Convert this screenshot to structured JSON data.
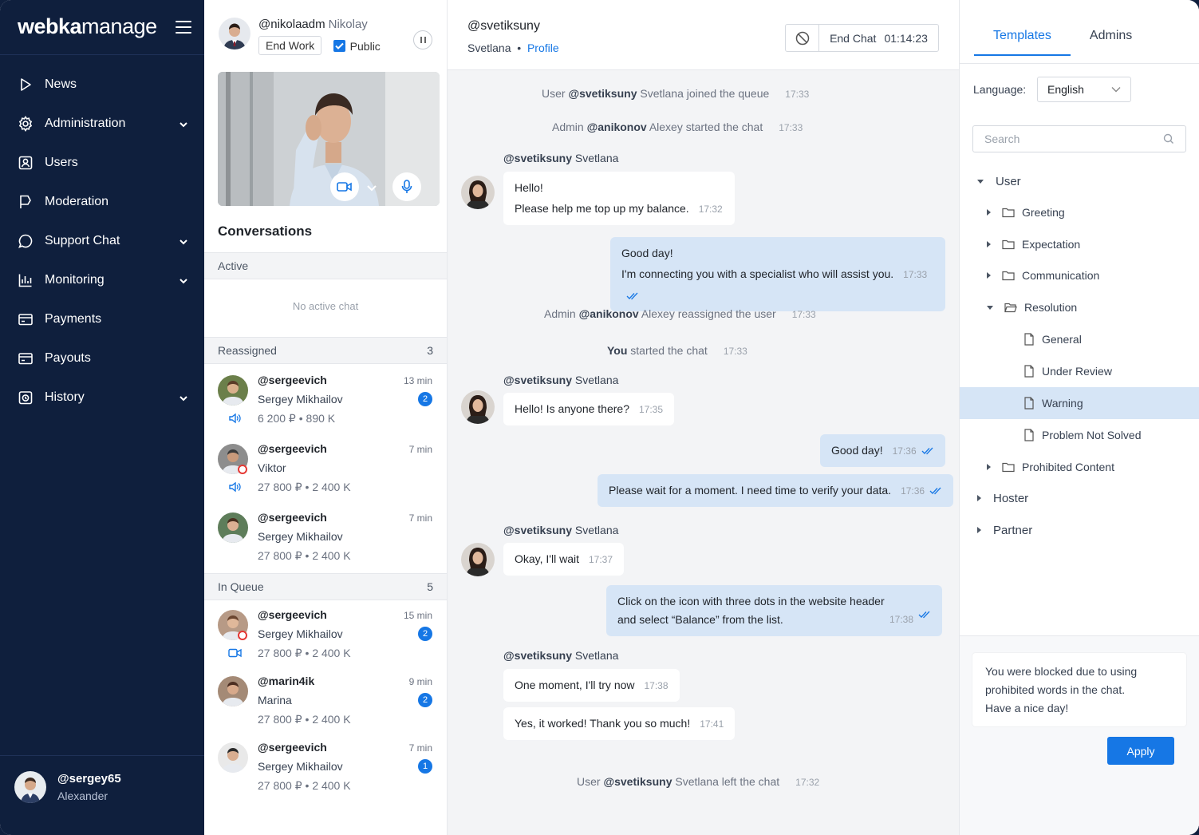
{
  "brand": {
    "bold": "webka",
    "light": "manage"
  },
  "nav": [
    {
      "label": "News",
      "icon": "play-triangle-icon",
      "expandable": false
    },
    {
      "label": "Administration",
      "icon": "gear-icon",
      "expandable": true
    },
    {
      "label": "Users",
      "icon": "user-card-icon",
      "expandable": false
    },
    {
      "label": "Moderation",
      "icon": "flag-icon",
      "expandable": false
    },
    {
      "label": "Support Chat",
      "icon": "chat-bubble-icon",
      "expandable": true
    },
    {
      "label": "Monitoring",
      "icon": "bar-chart-icon",
      "expandable": true
    },
    {
      "label": "Payments",
      "icon": "wallet-icon",
      "expandable": false
    },
    {
      "label": "Payouts",
      "icon": "wallet-icon",
      "expandable": false
    },
    {
      "label": "History",
      "icon": "history-icon",
      "expandable": true
    }
  ],
  "current_user": {
    "handle": "@sergey65",
    "name": "Alexander"
  },
  "operator": {
    "handle": "@nikolaadm",
    "name": "Nikolay",
    "end_work": "End Work",
    "public_label": "Public",
    "public_checked": true
  },
  "conversations": {
    "title": "Conversations",
    "active": {
      "label": "Active",
      "empty_text": "No active chat"
    },
    "reassigned": {
      "label": "Reassigned",
      "count": "3",
      "items": [
        {
          "handle": "@sergeevich",
          "name": "Sergey Mikhailov",
          "amount": "6 200 ₽",
          "amount2": "890 K",
          "time": "13 min",
          "badge": "2",
          "media": "speaker-icon",
          "online_dot": false
        },
        {
          "handle": "@sergeevich",
          "name": "Viktor",
          "amount": "27 800 ₽",
          "amount2": "2 400 K",
          "time": "7 min",
          "badge": "",
          "media": "speaker-icon",
          "online_dot": true
        },
        {
          "handle": "@sergeevich",
          "name": "Sergey Mikhailov",
          "amount": "27 800 ₽",
          "amount2": "2 400 K",
          "time": "7 min",
          "badge": "",
          "media": "",
          "online_dot": false
        }
      ]
    },
    "queue": {
      "label": "In Queue",
      "count": "5",
      "items": [
        {
          "handle": "@sergeevich",
          "name": "Sergey Mikhailov",
          "amount": "27 800 ₽",
          "amount2": "2 400 K",
          "time": "15 min",
          "badge": "2",
          "media": "video-camera-icon",
          "online_dot": true
        },
        {
          "handle": "@marin4ik",
          "name": "Marina",
          "amount": "27 800 ₽",
          "amount2": "2 400 K",
          "time": "9 min",
          "badge": "2",
          "media": "",
          "online_dot": false
        },
        {
          "handle": "@sergeevich",
          "name": "Sergey Mikhailov",
          "amount": "27 800 ₽",
          "amount2": "2 400 K",
          "time": "7 min",
          "badge": "1",
          "media": "",
          "online_dot": false
        }
      ]
    }
  },
  "chat": {
    "handle": "@svetiksuny",
    "name": "Svetlana",
    "profile_link": "Profile",
    "end_chat": "End Chat",
    "timer": "01:14:23",
    "system": [
      {
        "pre": "User",
        "who": "@svetiksuny",
        "post": "Svetlana joined the queue",
        "time": "17:33"
      },
      {
        "pre": "Admin",
        "who": "@anikonov",
        "post": "Alexey started the chat",
        "time": "17:33"
      },
      {
        "pre": "Admin",
        "who": "@anikonov",
        "post": "Alexey reassigned the user",
        "time": "17:33"
      },
      {
        "pre": "",
        "who": "You",
        "post": "started the chat",
        "time": "17:33"
      },
      {
        "pre": "User",
        "who": "@svetiksuny",
        "post": "Svetlana left the chat",
        "time": "17:32"
      }
    ],
    "sender_label": {
      "handle": "@svetiksuny",
      "name": "Svetlana"
    },
    "messages": [
      {
        "dir": "in",
        "lines": [
          "Hello!",
          "Please help me top up my balance."
        ],
        "time": "17:32"
      },
      {
        "dir": "out",
        "lines": [
          "Good day!",
          "I'm connecting you with a specialist who will assist you."
        ],
        "time": "17:33"
      },
      {
        "dir": "in",
        "lines": [
          "Hello! Is anyone there?"
        ],
        "time": "17:35"
      },
      {
        "dir": "out",
        "lines": [
          "Good day!"
        ],
        "time": "17:36"
      },
      {
        "dir": "out",
        "lines": [
          "Please wait for a moment. I need time to verify your data."
        ],
        "time": "17:36"
      },
      {
        "dir": "in",
        "lines": [
          "Okay, I'll wait"
        ],
        "time": "17:37"
      },
      {
        "dir": "out",
        "lines": [
          "Click on the icon with three dots in the website header",
          "and select “Balance” from the list."
        ],
        "time": "17:38"
      },
      {
        "dir": "in",
        "lines": [
          "One moment, I'll try now"
        ],
        "time": "17:38"
      },
      {
        "dir": "in",
        "lines": [
          "Yes, it worked! Thank you so much!"
        ],
        "time": "17:41"
      }
    ]
  },
  "templates": {
    "tabs": [
      "Templates",
      "Admins"
    ],
    "language_label": "Language:",
    "language_value": "English",
    "search_placeholder": "Search",
    "tree": [
      {
        "label": "User",
        "type": "root",
        "state": "open"
      },
      {
        "label": "Greeting",
        "type": "folder",
        "state": "closed"
      },
      {
        "label": "Expectation",
        "type": "folder",
        "state": "closed"
      },
      {
        "label": "Communication",
        "type": "folder",
        "state": "closed"
      },
      {
        "label": "Resolution",
        "type": "folder",
        "state": "open"
      },
      {
        "label": "General",
        "type": "file"
      },
      {
        "label": "Under Review",
        "type": "file"
      },
      {
        "label": "Warning",
        "type": "file",
        "selected": true
      },
      {
        "label": "Problem Not Solved",
        "type": "file"
      },
      {
        "label": "Prohibited Content",
        "type": "folder",
        "state": "closed"
      },
      {
        "label": "Hoster",
        "type": "root",
        "state": "closed"
      },
      {
        "label": "Partner",
        "type": "root",
        "state": "closed"
      }
    ],
    "preview_lines": [
      "You were blocked due to using",
      "prohibited words in the chat.",
      "Have a nice day!"
    ],
    "apply": "Apply"
  }
}
